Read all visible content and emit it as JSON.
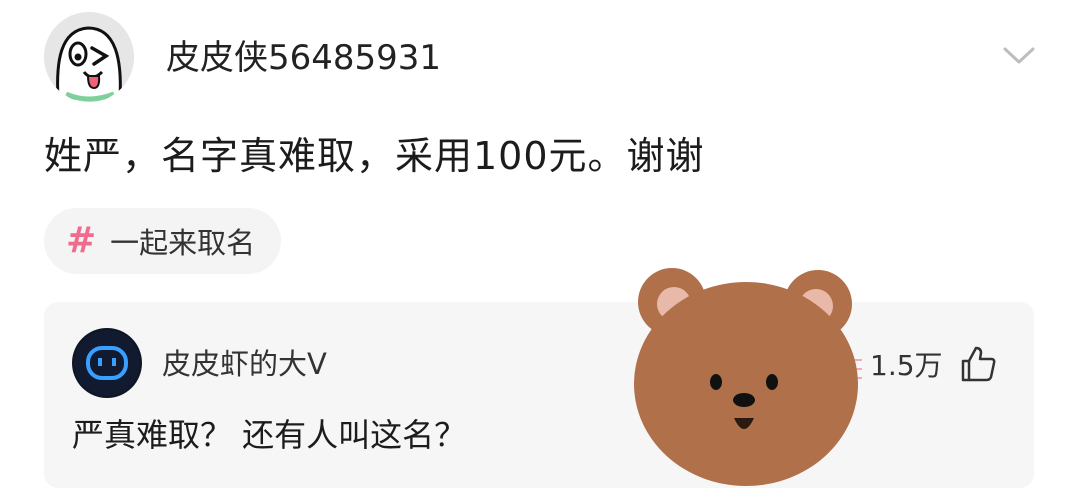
{
  "post": {
    "author": "皮皮侠56485931",
    "text": "姓严，名字真难取，采用100元。谢谢",
    "topic": "一起来取名",
    "topic_icon": "#",
    "accent_color": "#f06b8c"
  },
  "comment": {
    "author": "皮皮虾的大V",
    "likes": "1.5万",
    "text": "严真难取？ 还有人叫这名？"
  },
  "icons": {
    "avatar": "cartoon-tongue-face-avatar",
    "chevron": "chevron-down-icon",
    "comment_avatar": "blue-face-avatar",
    "like": "thumbs-up-icon",
    "sticker": "bear-sticker"
  }
}
